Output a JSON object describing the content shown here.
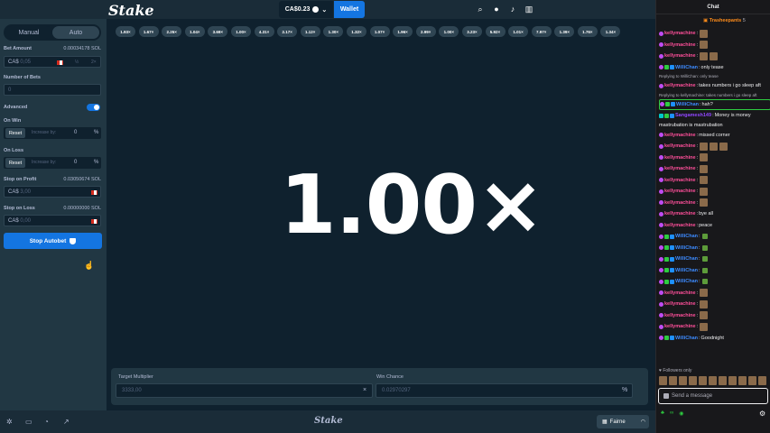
{
  "header": {
    "logo": "Stake",
    "balance": "CA$0.23",
    "wallet_label": "Wallet",
    "icons": [
      "search-icon",
      "user-icon",
      "bell-icon",
      "sidebar-icon"
    ]
  },
  "left": {
    "tabs": [
      {
        "label": "Manual"
      },
      {
        "label": "Auto"
      }
    ],
    "bet_amount_label": "Bet Amount",
    "bet_amount_value": "0.00034178 SOL",
    "bet_amount_input": "0,05",
    "bet_currency": "CA$",
    "half": "½",
    "double": "2×",
    "num_bets_label": "Number of Bets",
    "num_bets_value": "0",
    "advanced_label": "Advanced",
    "on_win_label": "On Win",
    "on_loss_label": "On Loss",
    "reset_label": "Reset",
    "increase_label": "Increase by:",
    "zero": "0",
    "pct": "%",
    "stop_profit_label": "Stop on Profit",
    "stop_profit_value": "0.03050674 SOL",
    "stop_profit_input": "3,00",
    "stop_loss_label": "Stop on Loss",
    "stop_loss_value": "0.00000000 SOL",
    "stop_loss_input": "0,00",
    "stop_autobet": "Stop Autobet"
  },
  "results": [
    "1.93×",
    "1.67×",
    "2.25×",
    "1.04×",
    "3.69×",
    "1.00×",
    "4.31×",
    "2.17×",
    "1.12×",
    "1.30×",
    "1.32×",
    "1.07×",
    "1.96×",
    "2.99×",
    "1.00×",
    "3.23×",
    "5.92×",
    "1.01×",
    "7.97×",
    "1.39×",
    "1.76×",
    "1.34×"
  ],
  "game": {
    "multiplier": "1.00×",
    "target_label": "Target Multiplier",
    "target_value": "3333,00",
    "win_chance_label": "Win Chance",
    "win_chance_value": "0.02970297",
    "clear": "×"
  },
  "footer": {
    "logo": "Stake",
    "fairness": "Fairne",
    "icons": [
      "settings-icon",
      "theater-icon",
      "stats-icon",
      "chart-icon"
    ]
  },
  "chat": {
    "title": "Chat",
    "pinned_user": "Trasheepants",
    "pinned_count": "5",
    "messages": [
      {
        "user": "kellymachine",
        "text": "",
        "badges": [
          "pink"
        ],
        "emotes": 1,
        "color": "kelly"
      },
      {
        "user": "kellymachine",
        "text": "",
        "badges": [
          "pink"
        ],
        "emotes": 1,
        "color": "kelly"
      },
      {
        "user": "kellymachine",
        "text": "",
        "badges": [
          "pink"
        ],
        "emotes": 2,
        "color": "kelly"
      },
      {
        "user": "WilliChan",
        "text": "only tease",
        "badges": [
          "pink",
          "green",
          "blue"
        ],
        "emotes": 0,
        "color": "willi"
      },
      {
        "user": "kellymachine",
        "text": "takes numbers i go sleep aft",
        "badges": [
          "pink"
        ],
        "emotes": 0,
        "color": "kelly",
        "reply": "Replying to WilliChan: only tease"
      },
      {
        "user": "WilliChan",
        "text": "hah?",
        "badges": [
          "pink",
          "green",
          "blue"
        ],
        "emotes": 0,
        "color": "willi",
        "reply": "Replying to kellymachine: takes numbers i go sleep aft",
        "highlight": true
      },
      {
        "user": "Sangamesh149",
        "text": "Money is money",
        "badges": [
          "teal",
          "green",
          "blue"
        ],
        "emotes": 0,
        "color": "sang",
        "extra": "mastrubation is mastrubation"
      },
      {
        "user": "kellymachine",
        "text": "missed corner",
        "badges": [
          "pink"
        ],
        "emotes": 0,
        "color": "kelly"
      },
      {
        "user": "kellymachine",
        "text": "",
        "badges": [
          "pink"
        ],
        "emotes": 3,
        "color": "kelly"
      },
      {
        "user": "kellymachine",
        "text": "",
        "badges": [
          "pink"
        ],
        "emotes": 1,
        "color": "kelly"
      },
      {
        "user": "kellymachine",
        "text": "",
        "badges": [
          "pink"
        ],
        "emotes": 1,
        "color": "kelly"
      },
      {
        "user": "kellymachine",
        "text": "",
        "badges": [
          "pink"
        ],
        "emotes": 1,
        "color": "kelly"
      },
      {
        "user": "kellymachine",
        "text": "",
        "badges": [
          "pink"
        ],
        "emotes": 1,
        "color": "kelly"
      },
      {
        "user": "kellymachine",
        "text": "",
        "badges": [
          "pink"
        ],
        "emotes": 1,
        "color": "kelly"
      },
      {
        "user": "kellymachine",
        "text": "bye all",
        "badges": [
          "pink"
        ],
        "emotes": 0,
        "color": "kelly"
      },
      {
        "user": "kellymachine",
        "text": "peace",
        "badges": [
          "pink"
        ],
        "emotes": 0,
        "color": "kelly"
      },
      {
        "user": "WilliChan",
        "text": "",
        "badges": [
          "pink",
          "green",
          "blue"
        ],
        "emotes": 1,
        "color": "willi",
        "small": true
      },
      {
        "user": "WilliChan",
        "text": "",
        "badges": [
          "pink",
          "green",
          "blue"
        ],
        "emotes": 1,
        "color": "willi",
        "small": true
      },
      {
        "user": "WilliChan",
        "text": "",
        "badges": [
          "pink",
          "green",
          "blue"
        ],
        "emotes": 1,
        "color": "willi",
        "small": true
      },
      {
        "user": "WilliChan",
        "text": "",
        "badges": [
          "pink",
          "green",
          "blue"
        ],
        "emotes": 1,
        "color": "willi",
        "small": true
      },
      {
        "user": "WilliChan",
        "text": "",
        "badges": [
          "pink",
          "green",
          "blue"
        ],
        "emotes": 1,
        "color": "willi",
        "small": true
      },
      {
        "user": "kellymachine",
        "text": "",
        "badges": [
          "pink"
        ],
        "emotes": 1,
        "color": "kelly"
      },
      {
        "user": "kellymachine",
        "text": "",
        "badges": [
          "pink"
        ],
        "emotes": 1,
        "color": "kelly"
      },
      {
        "user": "kellymachine",
        "text": "",
        "badges": [
          "pink"
        ],
        "emotes": 1,
        "color": "kelly"
      },
      {
        "user": "kellymachine",
        "text": "",
        "badges": [
          "pink"
        ],
        "emotes": 1,
        "color": "kelly"
      },
      {
        "user": "WilliChan",
        "text": "Goodnight",
        "badges": [
          "pink",
          "green",
          "blue"
        ],
        "emotes": 0,
        "color": "willi"
      }
    ],
    "followers_only": "Followers only",
    "input_placeholder": "Send a message",
    "footer_points": "∞"
  },
  "colors": {
    "bg": "#0f212e",
    "panel": "#213743",
    "accent": "#1475e1",
    "chat_bg": "#18181b"
  }
}
